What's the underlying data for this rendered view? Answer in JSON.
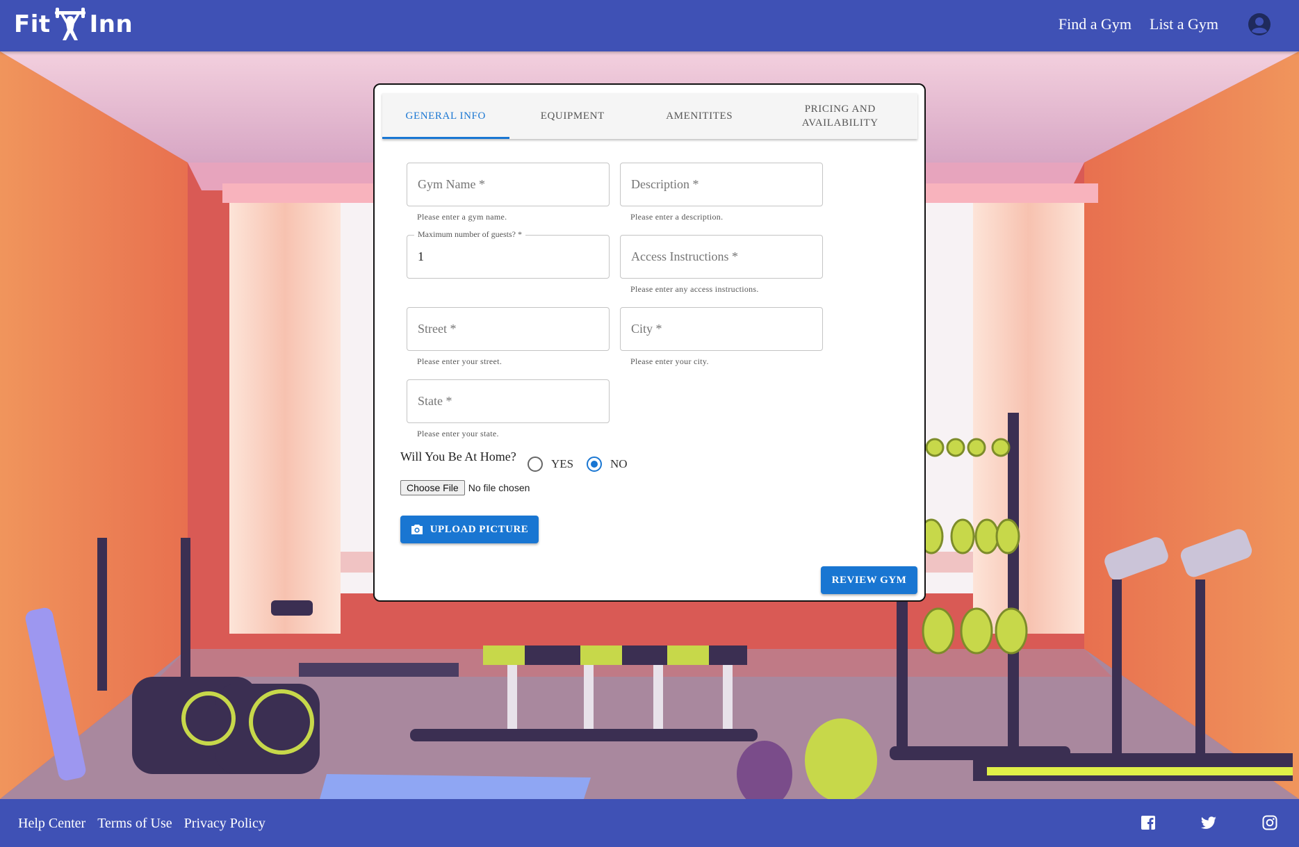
{
  "header": {
    "logo_left": "Fit",
    "logo_right": "Inn",
    "nav": {
      "find": "Find a Gym",
      "list": "List a Gym"
    }
  },
  "tabs": [
    "GENERAL INFO",
    "EQUIPMENT",
    "AMENITITES",
    "PRICING AND AVAILABILITY"
  ],
  "form": {
    "gym_name": {
      "placeholder": "Gym Name *",
      "helper": "Please enter a gym name."
    },
    "description": {
      "placeholder": "Description *",
      "helper": "Please enter a description."
    },
    "max_guests": {
      "label": "Maximum number of guests? *",
      "value": "1"
    },
    "access": {
      "placeholder": "Access Instructions *",
      "helper": "Please enter any access instructions."
    },
    "street": {
      "placeholder": "Street *",
      "helper": "Please enter your street."
    },
    "city": {
      "placeholder": "City *",
      "helper": "Please enter your city."
    },
    "state": {
      "placeholder": "State *",
      "helper": "Please enter your state."
    },
    "home_question": "Will You Be At Home?",
    "radio_yes": "YES",
    "radio_no": "NO",
    "choose_file": "Choose File",
    "no_file": "No file chosen",
    "upload_label": "UPLOAD PICTURE",
    "review_label": "REVIEW GYM"
  },
  "footer": {
    "help": "Help Center",
    "terms": "Terms of Use",
    "privacy": "Privacy Policy"
  },
  "colors": {
    "primary": "#3f51b5",
    "accent": "#1976d2"
  },
  "icons": [
    "account-icon",
    "camera-icon",
    "facebook-icon",
    "twitter-icon",
    "instagram-icon",
    "barbell-logo-icon"
  ]
}
